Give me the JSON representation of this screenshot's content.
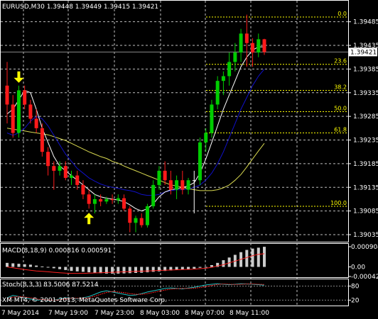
{
  "header": {
    "symbol": "EURUSD,M30",
    "ohlc": "1.39448 1.39449 1.39415 1.39421"
  },
  "colors": {
    "bull": "#00cc00",
    "bear": "#ff1a1a",
    "doji": "#ffffff",
    "ma_fast": "#ffffff",
    "ma_mid": "#1010c8",
    "ma_slow": "#d8d850",
    "fib": "#ffff00",
    "grid": "#ffffff",
    "arrow": "#ffff00"
  },
  "price_axis": {
    "ticks": [
      {
        "label": "1.39485",
        "value": 1.39485
      },
      {
        "label": "1.39435",
        "value": 1.39435
      },
      {
        "label": "1.39385",
        "value": 1.39385
      },
      {
        "label": "1.39335",
        "value": 1.39335
      },
      {
        "label": "1.39285",
        "value": 1.39285
      },
      {
        "label": "1.39235",
        "value": 1.39235
      },
      {
        "label": "1.39185",
        "value": 1.39185
      },
      {
        "label": "1.39135",
        "value": 1.39135
      },
      {
        "label": "1.39085",
        "value": 1.39085
      },
      {
        "label": "1.39035",
        "value": 1.39035
      }
    ],
    "current_price": "1.39421"
  },
  "fibonacci": {
    "levels": [
      {
        "label": "0.0",
        "value": 1.39495
      },
      {
        "label": "23.6",
        "value": 1.39395
      },
      {
        "label": "38.2",
        "value": 1.3934
      },
      {
        "label": "50.0",
        "value": 1.39295
      },
      {
        "label": "61.8",
        "value": 1.3925
      },
      {
        "label": "100.0",
        "value": 1.39095
      }
    ]
  },
  "candles": [
    [
      1.3935,
      1.394,
      1.3927,
      1.3931
    ],
    [
      1.3931,
      1.3933,
      1.3924,
      1.3925
    ],
    [
      1.3925,
      1.3935,
      1.3924,
      1.3934
    ],
    [
      1.3934,
      1.3935,
      1.393,
      1.3931
    ],
    [
      1.3931,
      1.3932,
      1.3927,
      1.3928
    ],
    [
      1.3928,
      1.393,
      1.3925,
      1.3926
    ],
    [
      1.3926,
      1.3927,
      1.392,
      1.3921
    ],
    [
      1.3921,
      1.3922,
      1.3916,
      1.3918
    ],
    [
      1.3918,
      1.3919,
      1.3913,
      1.3917
    ],
    [
      1.3917,
      1.3919,
      1.3916,
      1.3918
    ],
    [
      1.3918,
      1.3919,
      1.3915,
      1.39155
    ],
    [
      1.39155,
      1.3917,
      1.3914,
      1.3916
    ],
    [
      1.3916,
      1.3917,
      1.3913,
      1.3914
    ],
    [
      1.3914,
      1.3915,
      1.3911,
      1.3912
    ],
    [
      1.3912,
      1.3913,
      1.3909,
      1.391
    ],
    [
      1.391,
      1.3912,
      1.3908,
      1.3911
    ],
    [
      1.3911,
      1.3912,
      1.39095,
      1.39105
    ],
    [
      1.39105,
      1.39115,
      1.391,
      1.3911
    ],
    [
      1.3911,
      1.3912,
      1.391,
      1.39108
    ],
    [
      1.39108,
      1.3912,
      1.391,
      1.39112
    ],
    [
      1.39112,
      1.3912,
      1.39085,
      1.3909
    ],
    [
      1.3909,
      1.39095,
      1.3904,
      1.3906
    ],
    [
      1.3906,
      1.39075,
      1.3904,
      1.3907
    ],
    [
      1.3907,
      1.3908,
      1.3905,
      1.39055
    ],
    [
      1.39055,
      1.391,
      1.3905,
      1.39095
    ],
    [
      1.39095,
      1.3915,
      1.3909,
      1.3914
    ],
    [
      1.3914,
      1.3918,
      1.3913,
      1.3917
    ],
    [
      1.3917,
      1.3919,
      1.3914,
      1.3915
    ],
    [
      1.3915,
      1.3917,
      1.3912,
      1.3913
    ],
    [
      1.3913,
      1.3916,
      1.3911,
      1.3915
    ],
    [
      1.3915,
      1.3917,
      1.3912,
      1.3913
    ],
    [
      1.3913,
      1.39155,
      1.3912,
      1.3915
    ],
    [
      1.3915,
      1.3917,
      1.3908,
      1.3915
    ],
    [
      1.3915,
      1.3924,
      1.3914,
      1.3923
    ],
    [
      1.3923,
      1.3926,
      1.3921,
      1.3925
    ],
    [
      1.3925,
      1.3932,
      1.3924,
      1.3931
    ],
    [
      1.3931,
      1.3937,
      1.393,
      1.3936
    ],
    [
      1.3936,
      1.3938,
      1.3933,
      1.3937
    ],
    [
      1.3937,
      1.3942,
      1.3935,
      1.394
    ],
    [
      1.394,
      1.3944,
      1.3938,
      1.3942
    ],
    [
      1.3942,
      1.3947,
      1.394,
      1.3946
    ],
    [
      1.3946,
      1.395,
      1.3939,
      1.3944
    ],
    [
      1.3944,
      1.3945,
      1.3939,
      1.3942
    ],
    [
      1.3942,
      1.3946,
      1.3941,
      1.39448
    ],
    [
      1.39448,
      1.39449,
      1.39415,
      1.39421
    ]
  ],
  "moving_averages": {
    "fast": [
      1.3929,
      1.393,
      1.3932,
      1.3934,
      1.39335,
      1.393,
      1.3926,
      1.3923,
      1.392,
      1.3918,
      1.3917,
      1.3916,
      1.3915,
      1.3914,
      1.3913,
      1.3912,
      1.39115,
      1.39112,
      1.3911,
      1.39108,
      1.39105,
      1.39098,
      1.3909,
      1.39085,
      1.3909,
      1.391,
      1.39115,
      1.39125,
      1.3913,
      1.39132,
      1.39135,
      1.39138,
      1.39145,
      1.39165,
      1.39195,
      1.3923,
      1.39265,
      1.393,
      1.3933,
      1.3936,
      1.3939,
      1.3941,
      1.39425,
      1.39432,
      1.39432
    ],
    "mid": [
      1.3925,
      1.39245,
      1.3925,
      1.3926,
      1.39275,
      1.39285,
      1.3928,
      1.39265,
      1.39245,
      1.39225,
      1.39205,
      1.3919,
      1.39175,
      1.39165,
      1.39155,
      1.39148,
      1.39142,
      1.39138,
      1.39135,
      1.39133,
      1.3913,
      1.39128,
      1.39125,
      1.3912,
      1.39118,
      1.39118,
      1.3912,
      1.39125,
      1.39128,
      1.3913,
      1.3913,
      1.39131,
      1.39135,
      1.3914,
      1.3915,
      1.39165,
      1.39185,
      1.3921,
      1.3924,
      1.3927,
      1.393,
      1.39325,
      1.3935,
      1.3937,
      1.39385
    ],
    "slow": [
      1.3926,
      1.39258,
      1.39256,
      1.39254,
      1.39252,
      1.3925,
      1.39248,
      1.39246,
      1.39242,
      1.39238,
      1.39234,
      1.39228,
      1.39222,
      1.39216,
      1.3921,
      1.39205,
      1.392,
      1.39196,
      1.3919,
      1.39186,
      1.3918,
      1.39175,
      1.3917,
      1.39165,
      1.3916,
      1.39155,
      1.3915,
      1.39145,
      1.3914,
      1.39138,
      1.39135,
      1.39132,
      1.3913,
      1.39128,
      1.39128,
      1.39128,
      1.3913,
      1.39134,
      1.3914,
      1.3915,
      1.39162,
      1.39178,
      1.39195,
      1.39212,
      1.39228
    ]
  },
  "arrows": [
    {
      "type": "down",
      "candle": 2
    },
    {
      "type": "up",
      "candle": 14
    }
  ],
  "macd": {
    "label": "MACD(8,18,9) 0.000816 0.000591",
    "ticks": [
      {
        "label": "0.000904",
        "value": 0.000904
      },
      {
        "label": "0.00",
        "value": 0
      },
      {
        "label": "-0.000428",
        "value": -0.000428
      }
    ],
    "histogram": [
      0.00018,
      0.00016,
      0.00014,
      0.00012,
      0.0001,
      6e-05,
      2e-05,
      -2e-05,
      -6e-05,
      -0.0001,
      -0.00014,
      -0.00018,
      -0.0002,
      -0.00022,
      -0.00024,
      -0.00026,
      -0.00028,
      -0.0003,
      -0.0003,
      -0.0003,
      -0.00029,
      -0.00028,
      -0.00027,
      -0.00026,
      -0.00024,
      -0.00022,
      -0.0002,
      -0.00018,
      -0.00016,
      -0.00014,
      -0.00012,
      -0.0001,
      -8e-05,
      -4e-05,
      0.0,
      8e-05,
      0.00018,
      0.0003,
      0.00042,
      0.00054,
      0.00066,
      0.00076,
      0.00082,
      0.00086,
      0.0009
    ],
    "signal": [
      0.0,
      -4e-05,
      -8e-05,
      -0.00012,
      -0.00015,
      -0.00018,
      -0.0002,
      -0.00022,
      -0.00024,
      -0.00026,
      -0.00028,
      -0.00029,
      -0.00029,
      -0.00029,
      -0.00028,
      -0.00027,
      -0.00026,
      -0.00025,
      -0.00024,
      -0.00023,
      -0.00022,
      -0.00021,
      -0.0002,
      -0.00019,
      -0.00018,
      -0.00017,
      -0.00016,
      -0.00015,
      -0.00014,
      -0.00013,
      -0.00012,
      -0.00011,
      -0.0001,
      -8e-05,
      -6e-05,
      -2e-05,
      4e-05,
      0.0001,
      0.00018,
      0.00026,
      0.00034,
      0.00042,
      0.0005,
      0.00056,
      0.00059
    ]
  },
  "stoch": {
    "label": "Stoch(8,3,3) 83.5006 87.5214",
    "ticks": [
      {
        "label": "80",
        "value": 80
      },
      {
        "label": "20",
        "value": 20
      }
    ],
    "k": [
      30,
      40,
      35,
      30,
      25,
      20,
      22,
      18,
      20,
      25,
      30,
      28,
      26,
      30,
      35,
      45,
      55,
      60,
      55,
      50,
      45,
      40,
      42,
      48,
      55,
      60,
      65,
      70,
      72,
      70,
      68,
      72,
      75,
      80,
      85,
      88,
      90,
      88,
      86,
      88,
      90,
      89,
      88,
      86,
      84
    ],
    "d": [
      28,
      33,
      35,
      33,
      30,
      25,
      22,
      20,
      20,
      22,
      26,
      28,
      28,
      28,
      30,
      37,
      45,
      53,
      57,
      55,
      52,
      48,
      45,
      45,
      48,
      53,
      58,
      63,
      67,
      69,
      70,
      70,
      71,
      74,
      78,
      83,
      87,
      89,
      88,
      87,
      88,
      89,
      89,
      88,
      87
    ]
  },
  "footer": {
    "copyright": "XM MT4, © 2001-2013, MetaQuotes Software Corp."
  },
  "time_axis": {
    "labels": [
      {
        "label": "7 May 2014",
        "candle": 0
      },
      {
        "label": "7 May 19:00",
        "candle": 7
      },
      {
        "label": "7 May 23:00",
        "candle": 15
      },
      {
        "label": "8 May 03:00",
        "candle": 23
      },
      {
        "label": "8 May 07:00",
        "candle": 31
      },
      {
        "label": "8 May 11:00",
        "candle": 39
      }
    ]
  }
}
